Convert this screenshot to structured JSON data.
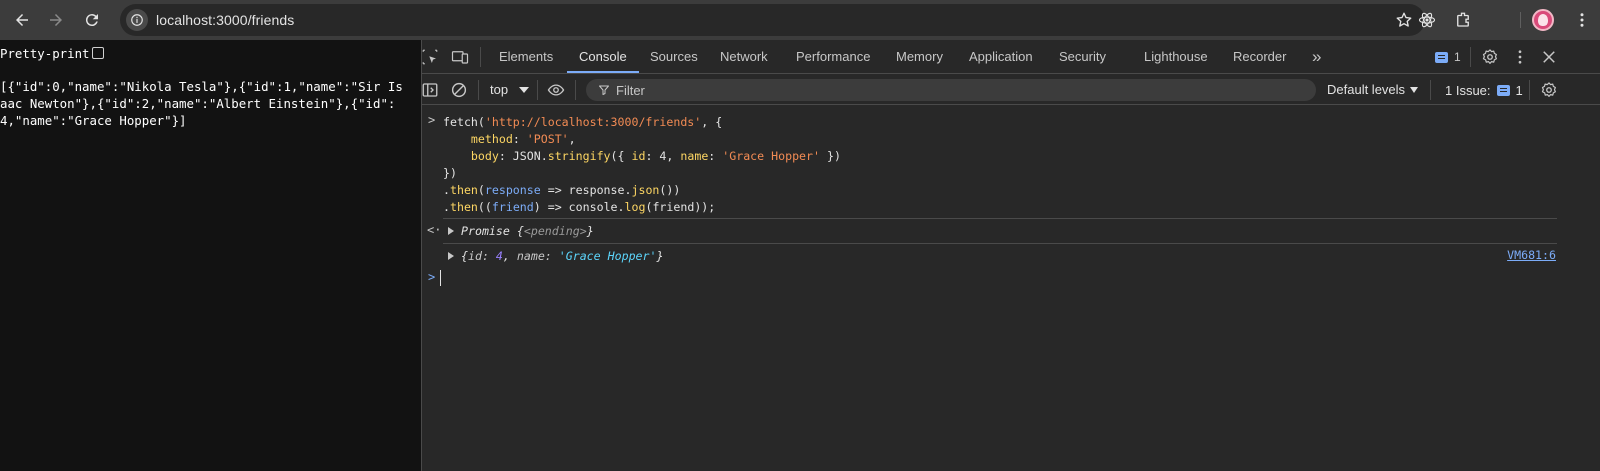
{
  "browser": {
    "url": "localhost:3000/friends",
    "icons": [
      "back-icon",
      "forward-icon",
      "reload-icon",
      "site-info-icon",
      "star-icon",
      "react-devtools-icon",
      "extensions-icon",
      "profile-avatar",
      "more-icon"
    ]
  },
  "page": {
    "pretty_print_label": "Pretty-print",
    "json_text": "[{\"id\":0,\"name\":\"Nikola Tesla\"},{\"id\":1,\"name\":\"Sir Isaac Newton\"},{\"id\":2,\"name\":\"Albert Einstein\"},{\"id\":4,\"name\":\"Grace Hopper\"}]"
  },
  "devtools": {
    "tabs": [
      "Elements",
      "Console",
      "Sources",
      "Network",
      "Performance",
      "Memory",
      "Application",
      "Security",
      "Lighthouse",
      "Recorder"
    ],
    "active_tab": "Console",
    "more_tabs": "»",
    "message_count": "1",
    "context": "top",
    "filter_placeholder": "Filter",
    "levels": "Default levels",
    "issues_label": "1 Issue:",
    "issues_count": "1",
    "colors": {
      "accent": "#7cacf8",
      "string": "#f28b54",
      "keyword": "#fdd663",
      "number": "#9980ff",
      "objstring": "#5cd5fb"
    }
  },
  "console": {
    "input_prompt": ">",
    "code": {
      "l1_a": "fetch(",
      "l1_str": "'http://localhost:3000/friends'",
      "l1_b": ", {",
      "l2_prop": "method",
      "l2_b": ": ",
      "l2_str": "'POST'",
      "l2_c": ",",
      "l3_prop": "body",
      "l3_b": ": JSON.",
      "l3_fn": "stringify",
      "l3_c": "({ ",
      "l3_k1": "id",
      "l3_d": ": 4, ",
      "l3_k2": "name",
      "l3_e": ": ",
      "l3_str": "'Grace Hopper'",
      "l3_f": " })",
      "l4": "})",
      "l5_a": ".",
      "l5_fn": "then",
      "l5_b": "(",
      "l5_p": "response",
      "l5_c": " => response.",
      "l5_fn2": "json",
      "l5_d": "())",
      "l6_a": ".",
      "l6_fn": "then",
      "l6_b": "((",
      "l6_p": "friend",
      "l6_c": ") => console.",
      "l6_fn2": "log",
      "l6_d": "(friend));"
    },
    "result_prompt": "<·",
    "promise_label": "Promise",
    "promise_open": "{",
    "promise_state": "<pending>",
    "promise_close": "}",
    "log_open": "{",
    "log_k1": "id",
    "log_v1": "4",
    "log_sep": ", ",
    "log_k2": "name",
    "log_v2": "'Grace Hopper'",
    "log_close": "}",
    "log_source": "VM681:6",
    "next_prompt": ">"
  }
}
